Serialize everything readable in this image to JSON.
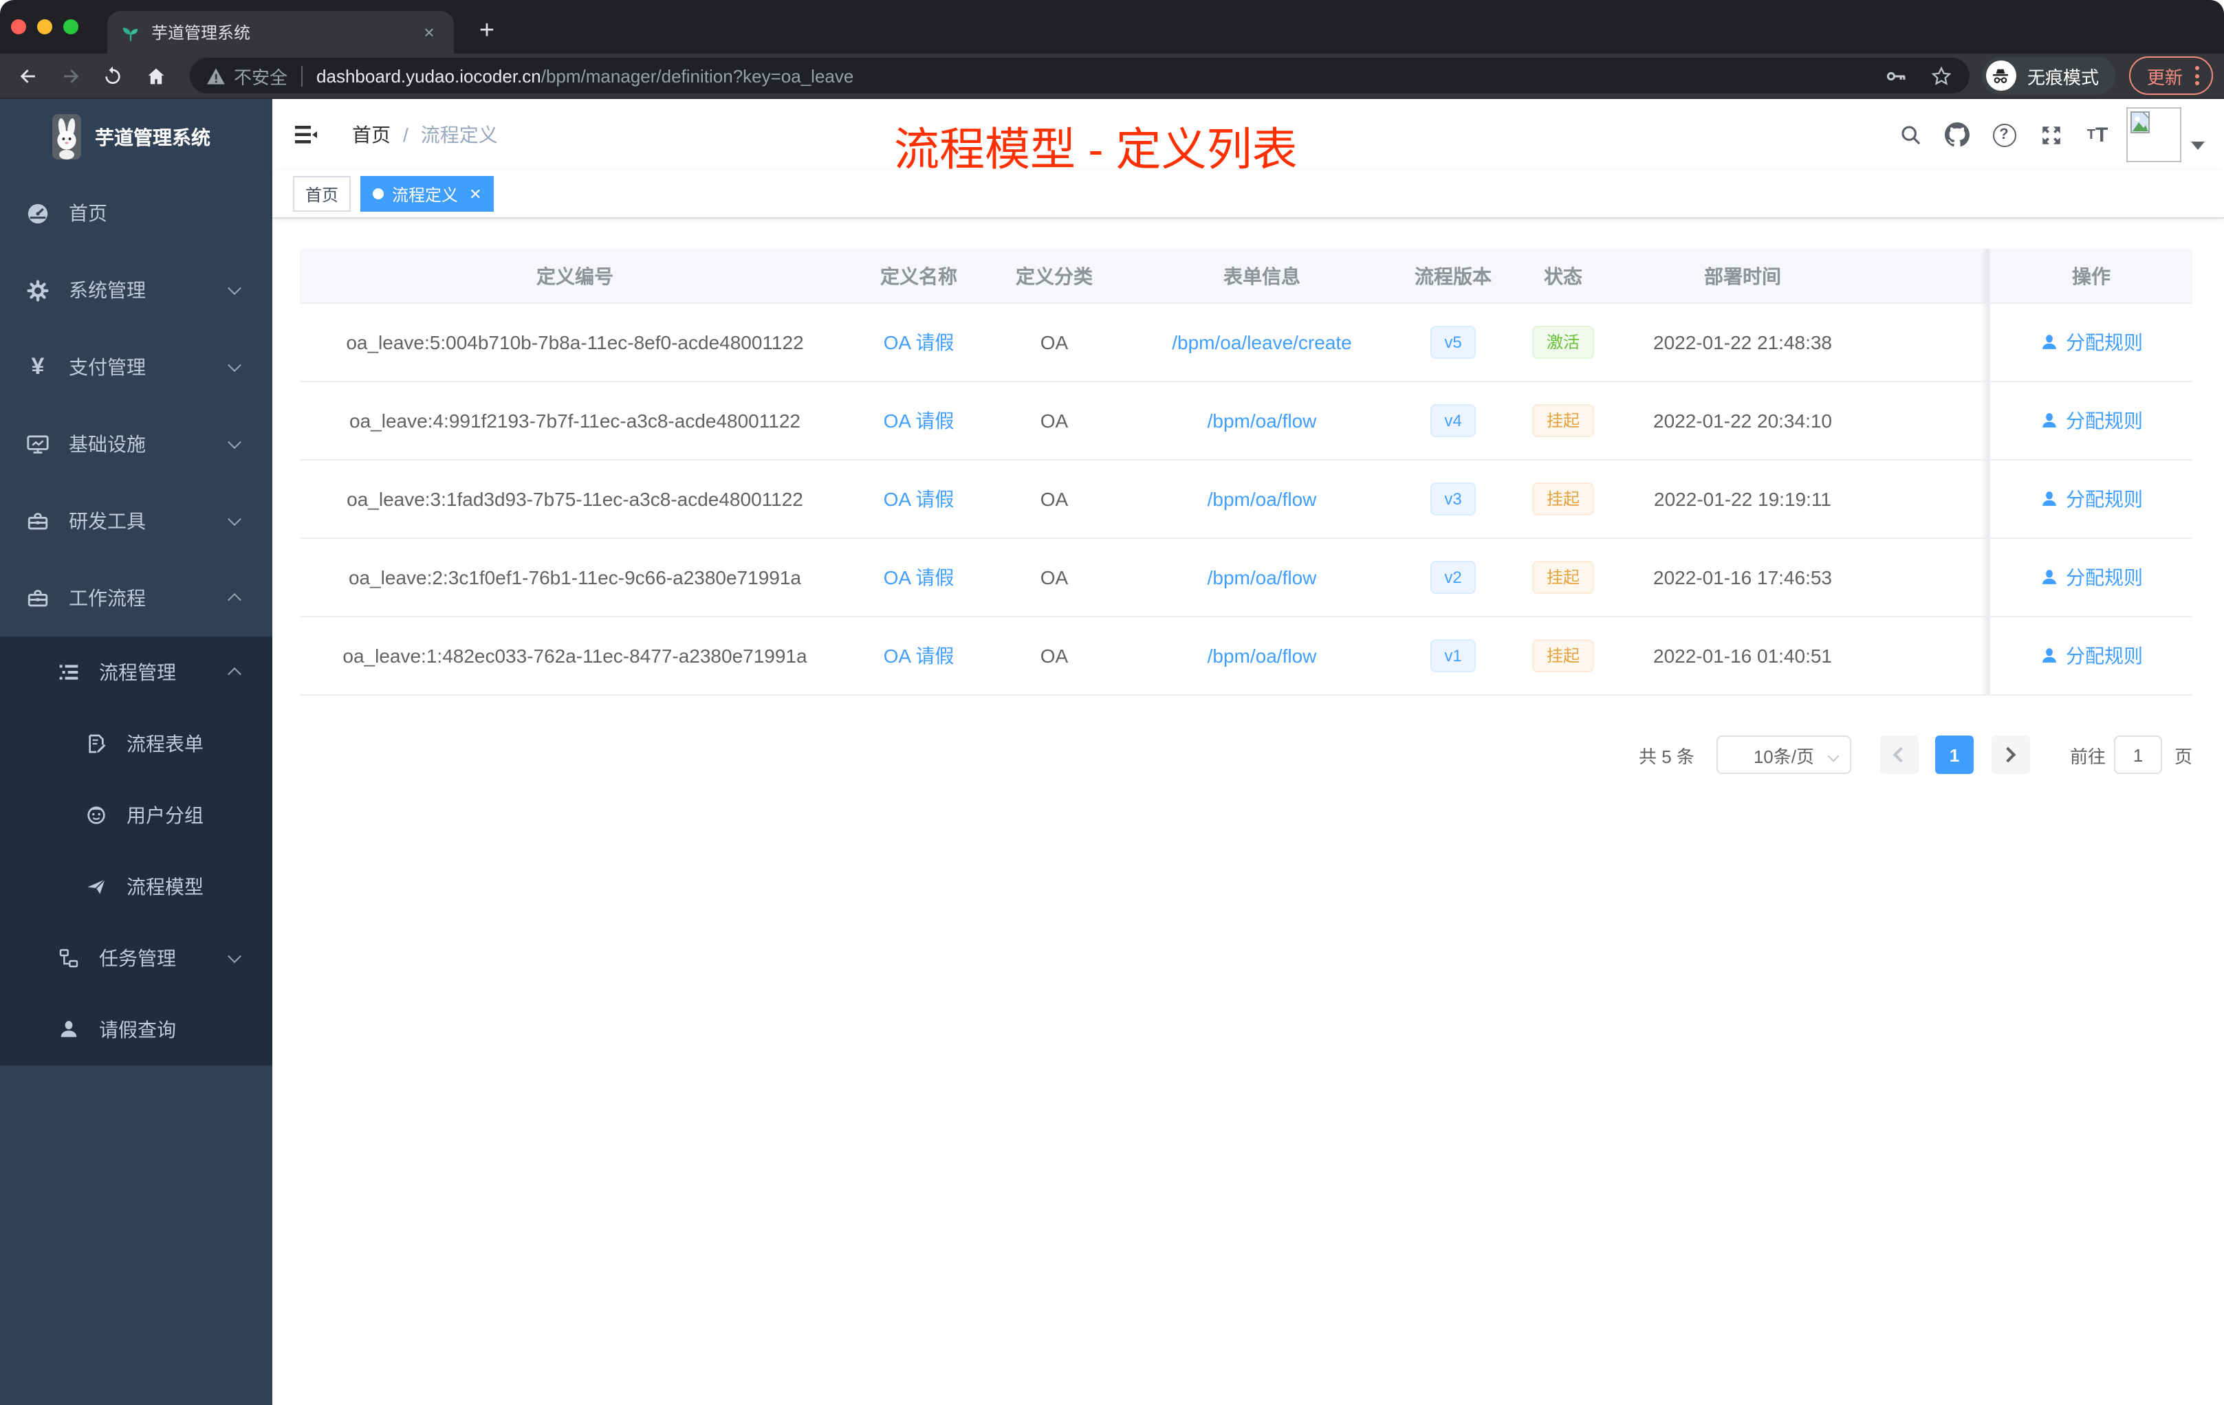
{
  "browser": {
    "tab": {
      "title": "芋道管理系统",
      "close": "×",
      "new_tab": "+"
    },
    "traffic_lights": [
      "#ff5f57",
      "#febc2e",
      "#28c840"
    ],
    "address": {
      "security_label": "不安全",
      "host": "dashboard.yudao.iocoder.cn",
      "path": "/bpm/manager/definition?key=oa_leave"
    },
    "actions": {
      "incognito_label": "无痕模式",
      "update_label": "更新"
    }
  },
  "sidebar": {
    "logo_title": "芋道管理系统",
    "items": [
      {
        "label": "首页",
        "icon": "dashboard-icon",
        "level": 1,
        "arrow": "none"
      },
      {
        "label": "系统管理",
        "icon": "gear-icon",
        "level": 1,
        "arrow": "down"
      },
      {
        "label": "支付管理",
        "icon": "yen-icon",
        "level": 1,
        "arrow": "down"
      },
      {
        "label": "基础设施",
        "icon": "monitor-icon",
        "level": 1,
        "arrow": "down"
      },
      {
        "label": "研发工具",
        "icon": "toolbox-icon",
        "level": 1,
        "arrow": "down"
      },
      {
        "label": "工作流程",
        "icon": "toolbox-icon",
        "level": 1,
        "arrow": "up"
      },
      {
        "label": "流程管理",
        "icon": "tree-table-icon",
        "level": 2,
        "arrow": "up"
      },
      {
        "label": "流程表单",
        "icon": "form-icon",
        "level": 3,
        "arrow": "none"
      },
      {
        "label": "用户分组",
        "icon": "people-icon",
        "level": 3,
        "arrow": "none"
      },
      {
        "label": "流程模型",
        "icon": "paper-plane-icon",
        "level": 3,
        "arrow": "none"
      },
      {
        "label": "任务管理",
        "icon": "tree-icon",
        "level": 2,
        "arrow": "down"
      },
      {
        "label": "请假查询",
        "icon": "user-icon",
        "level": 2,
        "arrow": "none"
      }
    ]
  },
  "navbar": {
    "breadcrumb": {
      "home": "首页",
      "separator": "/",
      "current": "流程定义"
    },
    "annotation": {
      "text": "流程模型 - 定义列表",
      "color": "#ff2f00"
    }
  },
  "tags": [
    {
      "label": "首页",
      "active": false
    },
    {
      "label": "流程定义",
      "active": true
    }
  ],
  "table": {
    "columns": [
      "定义编号",
      "定义名称",
      "定义分类",
      "表单信息",
      "流程版本",
      "状态",
      "部署时间",
      "操作"
    ],
    "action_label": "分配规则",
    "rows": [
      {
        "id": "oa_leave:5:004b710b-7b8a-11ec-8ef0-acde48001122",
        "name": "OA 请假",
        "category": "OA",
        "form": "/bpm/oa/leave/create",
        "version": "v5",
        "status": "激活",
        "status_type": "success",
        "deployed_at": "2022-01-22 21:48:38"
      },
      {
        "id": "oa_leave:4:991f2193-7b7f-11ec-a3c8-acde48001122",
        "name": "OA 请假",
        "category": "OA",
        "form": "/bpm/oa/flow",
        "version": "v4",
        "status": "挂起",
        "status_type": "warning",
        "deployed_at": "2022-01-22 20:34:10"
      },
      {
        "id": "oa_leave:3:1fad3d93-7b75-11ec-a3c8-acde48001122",
        "name": "OA 请假",
        "category": "OA",
        "form": "/bpm/oa/flow",
        "version": "v3",
        "status": "挂起",
        "status_type": "warning",
        "deployed_at": "2022-01-22 19:19:11"
      },
      {
        "id": "oa_leave:2:3c1f0ef1-76b1-11ec-9c66-a2380e71991a",
        "name": "OA 请假",
        "category": "OA",
        "form": "/bpm/oa/flow",
        "version": "v2",
        "status": "挂起",
        "status_type": "warning",
        "deployed_at": "2022-01-16 17:46:53"
      },
      {
        "id": "oa_leave:1:482ec033-762a-11ec-8477-a2380e71991a",
        "name": "OA 请假",
        "category": "OA",
        "form": "/bpm/oa/flow",
        "version": "v1",
        "status": "挂起",
        "status_type": "warning",
        "deployed_at": "2022-01-16 01:40:51"
      }
    ]
  },
  "pagination": {
    "total": "共 5 条",
    "page_size": "10条/页",
    "current_page": "1",
    "goto_label": "前往",
    "goto_value": "1",
    "page_unit": "页"
  },
  "colors": {
    "accent": "#409eff",
    "link": "#409eff",
    "tag_active_bg": "#409eff",
    "success_text": "#67c23a",
    "success_bg": "#f0f9eb",
    "warning_text": "#e6a23c",
    "warning_bg": "#fdf6ec",
    "sidebar_bg": "#304156",
    "submenu_bg": "#1f2d3d",
    "annotation": "#ff2f00"
  }
}
